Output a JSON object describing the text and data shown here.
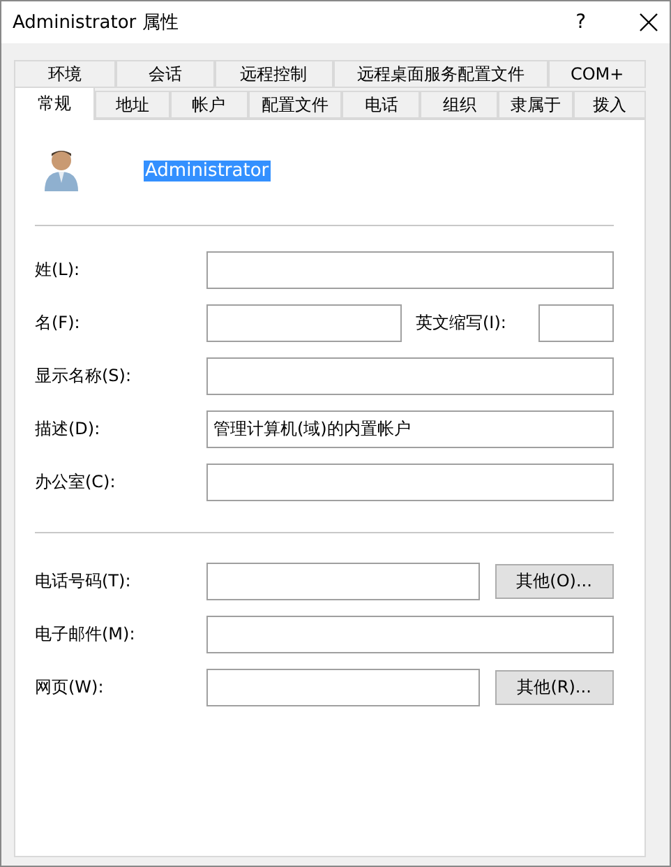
{
  "window": {
    "title": "Administrator 属性",
    "help": "?"
  },
  "tab_rows": [
    {
      "tabs": [
        {
          "label": "环境",
          "selected": false
        },
        {
          "label": "会话",
          "selected": false
        },
        {
          "label": "远程控制",
          "selected": false
        },
        {
          "label": "远程桌面服务配置文件",
          "selected": false
        },
        {
          "label": "COM+",
          "selected": false
        }
      ]
    },
    {
      "tabs": [
        {
          "label": "常规",
          "selected": true
        },
        {
          "label": "地址",
          "selected": false
        },
        {
          "label": "帐户",
          "selected": false
        },
        {
          "label": "配置文件",
          "selected": false
        },
        {
          "label": "电话",
          "selected": false
        },
        {
          "label": "组织",
          "selected": false
        },
        {
          "label": "隶属于",
          "selected": false
        },
        {
          "label": "拨入",
          "selected": false
        }
      ]
    }
  ],
  "user": {
    "name": "Administrator",
    "selected": true
  },
  "sections": [
    {
      "rows": [
        {
          "kind": "full",
          "label": "姓(L):"
        },
        {
          "kind": "split",
          "label": "名(F):",
          "extra_label": "英文缩写(I):"
        },
        {
          "kind": "full",
          "label": "显示名称(S):"
        },
        {
          "kind": "full",
          "label": "描述(D):",
          "value": "管理计算机(域)的内置帐户"
        },
        {
          "kind": "full",
          "label": "办公室(C):"
        }
      ]
    },
    {
      "rows": [
        {
          "kind": "button",
          "label": "电话号码(T):",
          "button": "其他(O)..."
        },
        {
          "kind": "full",
          "label": "电子邮件(M):"
        },
        {
          "kind": "button",
          "label": "网页(W):",
          "button": "其他(R)..."
        }
      ]
    }
  ]
}
